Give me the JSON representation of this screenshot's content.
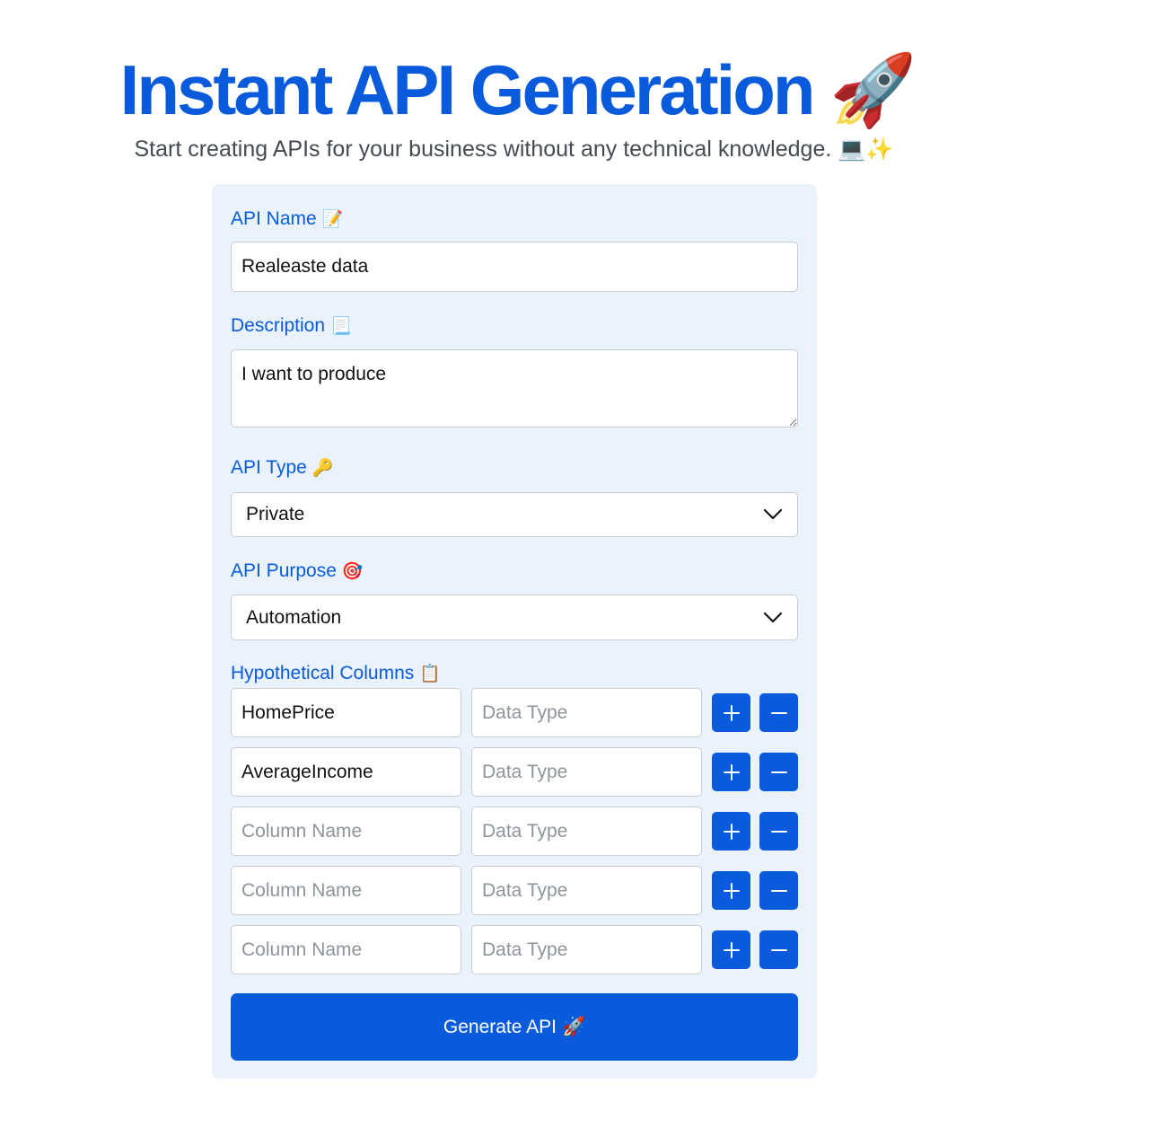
{
  "header": {
    "title": "Instant API Generation",
    "title_emoji": "🚀",
    "subtitle": "Start creating APIs for your business without any technical knowledge.",
    "subtitle_emoji": "💻✨"
  },
  "form": {
    "api_name": {
      "label": "API Name",
      "emoji": "📝",
      "value": "Realeaste data"
    },
    "description": {
      "label": "Description",
      "emoji": "📃",
      "value": "I want to produce"
    },
    "api_type": {
      "label": "API Type",
      "emoji": "🔑",
      "selected": "Private"
    },
    "api_purpose": {
      "label": "API Purpose",
      "emoji": "🎯",
      "selected": "Automation"
    },
    "columns": {
      "label": "Hypothetical Columns",
      "emoji": "📋",
      "name_placeholder": "Column Name",
      "type_placeholder": "Data Type",
      "rows": [
        {
          "name": "HomePrice",
          "type": ""
        },
        {
          "name": "AverageIncome",
          "type": ""
        },
        {
          "name": "",
          "type": ""
        },
        {
          "name": "",
          "type": ""
        },
        {
          "name": "",
          "type": ""
        }
      ]
    },
    "submit": {
      "label": "Generate API",
      "emoji": "🚀"
    }
  },
  "colors": {
    "accent": "#0a5bdc",
    "card_bg": "#eaf3fd",
    "subtitle": "#454b53"
  },
  "icons": {
    "add": "plus-icon",
    "remove": "minus-icon",
    "select": "chevron-down-icon"
  }
}
